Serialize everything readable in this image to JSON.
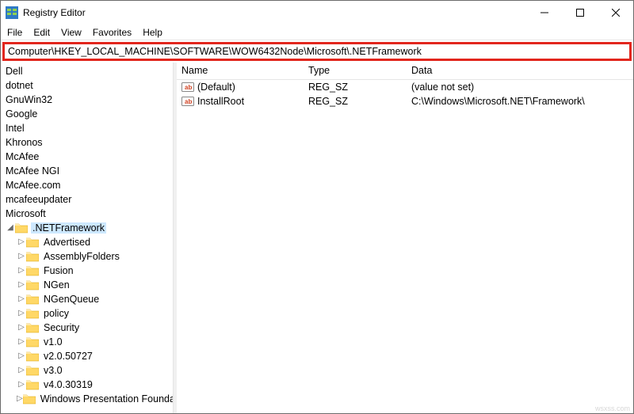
{
  "title": "Registry Editor",
  "menu": {
    "file": "File",
    "edit": "Edit",
    "view": "View",
    "favorites": "Favorites",
    "help": "Help"
  },
  "address": "Computer\\HKEY_LOCAL_MACHINE\\SOFTWARE\\WOW6432Node\\Microsoft\\.NETFramework",
  "columns": {
    "name": "Name",
    "type": "Type",
    "data": "Data"
  },
  "tree": {
    "items": [
      {
        "label": "Dell",
        "level": 0,
        "expandable": false,
        "expanded": false,
        "selected": false
      },
      {
        "label": "dotnet",
        "level": 0,
        "expandable": false,
        "expanded": false,
        "selected": false
      },
      {
        "label": "GnuWin32",
        "level": 0,
        "expandable": false,
        "expanded": false,
        "selected": false
      },
      {
        "label": "Google",
        "level": 0,
        "expandable": false,
        "expanded": false,
        "selected": false
      },
      {
        "label": "Intel",
        "level": 0,
        "expandable": false,
        "expanded": false,
        "selected": false
      },
      {
        "label": "Khronos",
        "level": 0,
        "expandable": false,
        "expanded": false,
        "selected": false
      },
      {
        "label": "McAfee",
        "level": 0,
        "expandable": false,
        "expanded": false,
        "selected": false
      },
      {
        "label": "McAfee NGI",
        "level": 0,
        "expandable": false,
        "expanded": false,
        "selected": false
      },
      {
        "label": "McAfee.com",
        "level": 0,
        "expandable": false,
        "expanded": false,
        "selected": false
      },
      {
        "label": "mcafeeupdater",
        "level": 0,
        "expandable": false,
        "expanded": false,
        "selected": false
      },
      {
        "label": "Microsoft",
        "level": 0,
        "expandable": false,
        "expanded": false,
        "selected": false
      },
      {
        "label": ".NETFramework",
        "level": 1,
        "expandable": true,
        "expanded": true,
        "selected": true
      },
      {
        "label": "Advertised",
        "level": 2,
        "expandable": true,
        "expanded": false,
        "selected": false
      },
      {
        "label": "AssemblyFolders",
        "level": 2,
        "expandable": true,
        "expanded": false,
        "selected": false
      },
      {
        "label": "Fusion",
        "level": 2,
        "expandable": true,
        "expanded": false,
        "selected": false
      },
      {
        "label": "NGen",
        "level": 2,
        "expandable": true,
        "expanded": false,
        "selected": false
      },
      {
        "label": "NGenQueue",
        "level": 2,
        "expandable": true,
        "expanded": false,
        "selected": false
      },
      {
        "label": "policy",
        "level": 2,
        "expandable": true,
        "expanded": false,
        "selected": false
      },
      {
        "label": "Security",
        "level": 2,
        "expandable": true,
        "expanded": false,
        "selected": false
      },
      {
        "label": "v1.0",
        "level": 2,
        "expandable": true,
        "expanded": false,
        "selected": false
      },
      {
        "label": "v2.0.50727",
        "level": 2,
        "expandable": true,
        "expanded": false,
        "selected": false
      },
      {
        "label": "v3.0",
        "level": 2,
        "expandable": true,
        "expanded": false,
        "selected": false
      },
      {
        "label": "v4.0.30319",
        "level": 2,
        "expandable": true,
        "expanded": false,
        "selected": false
      },
      {
        "label": "Windows Presentation Foundat",
        "level": 2,
        "expandable": true,
        "expanded": false,
        "selected": false
      }
    ]
  },
  "values": [
    {
      "name": "(Default)",
      "type": "REG_SZ",
      "data": "(value not set)"
    },
    {
      "name": "InstallRoot",
      "type": "REG_SZ",
      "data": "C:\\Windows\\Microsoft.NET\\Framework\\"
    }
  ],
  "watermark": "wsxss.com"
}
